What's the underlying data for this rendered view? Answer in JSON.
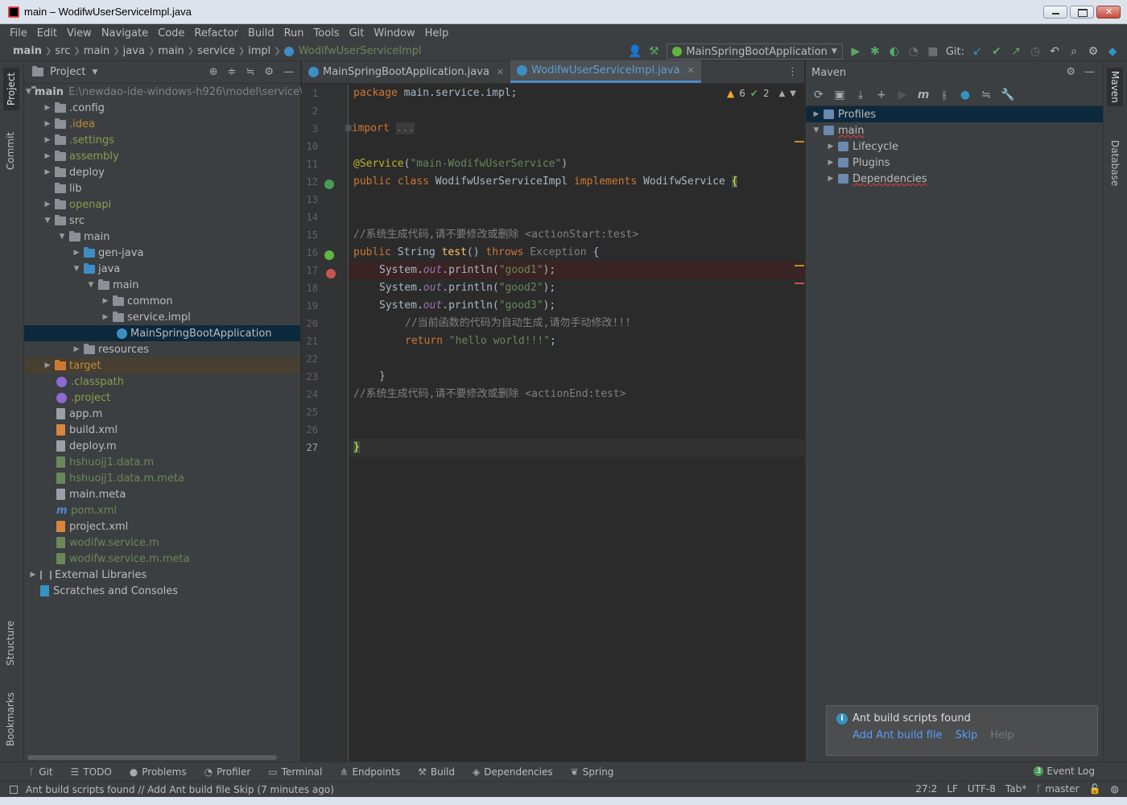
{
  "window": {
    "title": "main – WodifwUserServiceImpl.java"
  },
  "menu": [
    "File",
    "Edit",
    "View",
    "Navigate",
    "Code",
    "Refactor",
    "Build",
    "Run",
    "Tools",
    "Git",
    "Window",
    "Help"
  ],
  "breadcrumb": [
    "main",
    "src",
    "main",
    "java",
    "main",
    "service",
    "impl",
    "WodifwUserServiceImpl"
  ],
  "toolbar": {
    "run_config": "MainSpringBootApplication",
    "git_label": "Git:"
  },
  "left_tabs": {
    "project": "Project",
    "commit": "Commit",
    "structure": "Structure",
    "bookmarks": "Bookmarks"
  },
  "right_tabs": {
    "maven": "Maven",
    "database": "Database"
  },
  "project": {
    "header": "Project",
    "root_name": "main",
    "root_path": "E:\\newdao-ide-windows-h926\\model\\service\\",
    "items": [
      {
        "label": ".config"
      },
      {
        "label": ".idea"
      },
      {
        "label": ".settings"
      },
      {
        "label": "assembly"
      },
      {
        "label": "deploy"
      },
      {
        "label": "lib"
      },
      {
        "label": "openapi"
      },
      {
        "label": "src"
      },
      {
        "label": "main"
      },
      {
        "label": "gen-java"
      },
      {
        "label": "java"
      },
      {
        "label": "main"
      },
      {
        "label": "common"
      },
      {
        "label": "service.impl"
      },
      {
        "label": "MainSpringBootApplication"
      },
      {
        "label": "resources"
      },
      {
        "label": "target"
      },
      {
        "label": ".classpath"
      },
      {
        "label": ".project"
      },
      {
        "label": "app.m"
      },
      {
        "label": "build.xml"
      },
      {
        "label": "deploy.m"
      },
      {
        "label": "hshuojj1.data.m"
      },
      {
        "label": "hshuojj1.data.m.meta"
      },
      {
        "label": "main.meta"
      },
      {
        "label": "pom.xml"
      },
      {
        "label": "project.xml"
      },
      {
        "label": "wodifw.service.m"
      },
      {
        "label": "wodifw.service.m.meta"
      },
      {
        "label": "External Libraries"
      },
      {
        "label": "Scratches and Consoles"
      }
    ]
  },
  "editor": {
    "tabs": [
      {
        "label": "MainSpringBootApplication.java"
      },
      {
        "label": "WodifwUserServiceImpl.java"
      }
    ],
    "warnings": "6",
    "weak_warnings": "2",
    "line_numbers": [
      "1",
      "2",
      "3",
      "10",
      "11",
      "12",
      "13",
      "14",
      "15",
      "16",
      "17",
      "18",
      "19",
      "20",
      "21",
      "22",
      "23",
      "24",
      "25",
      "26",
      "27"
    ],
    "code": {
      "l1_kw": "package",
      "l1_rest": " main.service.impl;",
      "l3_kw": "import",
      "l3_fold": "...",
      "l11_ann": "@Service",
      "l11_open": "(",
      "l11_str": "\"main-WodifwUserService\"",
      "l11_close": ")",
      "l12_kw1": "public",
      "l12_kw2": "class",
      "l12_name": "WodifwUserServiceImpl",
      "l12_kw3": "implements",
      "l12_iface": "WodifwService",
      "l12_brace": "{",
      "l15_cmt": "//系统生成代码,请不要修改或删除 <actionStart:test>",
      "l16_kw": "public",
      "l16_type": "String",
      "l16_fn": "test",
      "l16_params": "()",
      "l16_throws": "throws",
      "l16_exc": "Exception",
      "l16_brace": "{",
      "print_prefix": "System.",
      "print_field": "out",
      "print_call": ".println(",
      "l17_str": "\"good1\"",
      "l18_str": "\"good2\"",
      "l19_str": "\"good3\"",
      "print_end": ");",
      "l20_cmt": "//当前函数的代码为自动生成,请勿手动修改!!!",
      "l21_kw": "return",
      "l21_str": "\"hello world!!!\"",
      "l21_end": ";",
      "l23_brace": "}",
      "l24_cmt": "//系统生成代码,请不要修改或删除 <actionEnd:test>",
      "l27_brace": "}"
    }
  },
  "maven": {
    "header": "Maven",
    "items": [
      {
        "label": "Profiles"
      },
      {
        "label": "main"
      },
      {
        "label": "Lifecycle"
      },
      {
        "label": "Plugins"
      },
      {
        "label": "Dependencies"
      }
    ],
    "notification": {
      "title": "Ant build scripts found",
      "action_add": "Add Ant build file",
      "action_skip": "Skip",
      "action_help": "Help"
    }
  },
  "bottom_tools": [
    "Git",
    "TODO",
    "Problems",
    "Profiler",
    "Terminal",
    "Endpoints",
    "Build",
    "Dependencies",
    "Spring"
  ],
  "event_log": {
    "count": "3",
    "label": "Event Log"
  },
  "status": {
    "message": "Ant build scripts found // Add Ant build file    Skip (7 minutes ago)",
    "position": "27:2",
    "line_sep": "LF",
    "encoding": "UTF-8",
    "indent": "Tab*",
    "branch": "master"
  }
}
